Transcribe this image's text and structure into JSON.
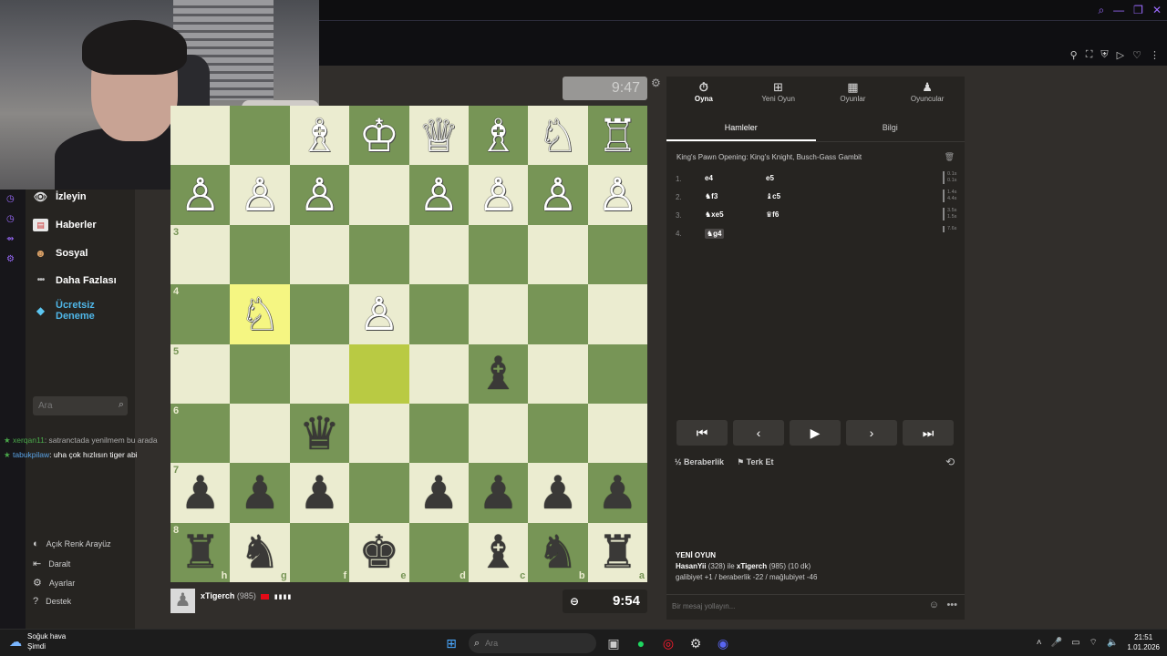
{
  "sidebar": {
    "items": [
      {
        "label": "İzleyin",
        "icon": "binoculars-icon"
      },
      {
        "label": "Haberler",
        "icon": "news-icon"
      },
      {
        "label": "Sosyal",
        "icon": "social-icon"
      },
      {
        "label": "Daha Fazlası",
        "icon": "more-icon"
      },
      {
        "label": "Ücretsiz Deneme",
        "icon": "diamond-icon"
      }
    ],
    "search_placeholder": "Ara",
    "bottom": [
      {
        "label": "Açık Renk Arayüz"
      },
      {
        "label": "Daralt"
      },
      {
        "label": "Ayarlar"
      },
      {
        "label": "Destek"
      }
    ]
  },
  "chat": [
    {
      "user": "xerqan11",
      "text": ": satranctada yenilmem bu arada"
    },
    {
      "user": "tabukpilaw",
      "text": ": uha çok hızlısın tiger abi"
    }
  ],
  "game": {
    "opponent_clock": "9:47",
    "player": {
      "name": "xTigerch",
      "rating": "(985)"
    },
    "player_clock": "9:54",
    "board": [
      [
        "",
        "",
        "♗",
        "♔",
        "♕",
        "♗",
        "♘",
        "♖"
      ],
      [
        "♙",
        "♙",
        "♙",
        "",
        "♙",
        "♙",
        "♙",
        "♙"
      ],
      [
        "",
        "",
        "",
        "",
        "",
        "",
        "",
        ""
      ],
      [
        "",
        "♘",
        "",
        "♙",
        "",
        "",
        "",
        ""
      ],
      [
        "",
        "",
        "",
        "",
        "",
        "♝",
        "",
        ""
      ],
      [
        "",
        "",
        "♛",
        "",
        "",
        "",
        "",
        ""
      ],
      [
        "♟",
        "♟",
        "♟",
        "",
        "♟",
        "♟",
        "♟",
        "♟"
      ],
      [
        "♜",
        "♞",
        "",
        "♚",
        "",
        "♝",
        "♞",
        "♜"
      ]
    ],
    "rank_labels": [
      "",
      "",
      "3",
      "4",
      "5",
      "6",
      "7",
      "8"
    ],
    "file_labels": [
      "h",
      "g",
      "f",
      "e",
      "d",
      "c",
      "b",
      "a"
    ],
    "highlight_light": "#f5f682",
    "highlight_dark": "#b9ca43",
    "board_light": "#ebecd0",
    "board_dark": "#779556"
  },
  "panel": {
    "tabs": [
      {
        "label": "Oyna",
        "icon": "stopwatch-icon"
      },
      {
        "label": "Yeni Oyun",
        "icon": "plus-icon"
      },
      {
        "label": "Oyunlar",
        "icon": "board-icon"
      },
      {
        "label": "Oyuncular",
        "icon": "players-icon"
      }
    ],
    "subtabs": [
      "Hamleler",
      "Bilgi"
    ],
    "opening": "King's Pawn Opening: King's Knight, Busch-Gass Gambit",
    "moves": [
      {
        "num": "1.",
        "white": "e4",
        "black": "e5",
        "times": [
          "0.1s",
          "0.1s"
        ]
      },
      {
        "num": "2.",
        "white": "♞f3",
        "black": "♝c5",
        "times": [
          "1.4s",
          "4.4s"
        ]
      },
      {
        "num": "3.",
        "white": "♞xe5",
        "black": "♛f6",
        "times": [
          "3.5s",
          "1.5s"
        ]
      },
      {
        "num": "4.",
        "white": "♞g4",
        "black": "",
        "times": [
          "7.6s",
          ""
        ]
      }
    ],
    "draw_label": "Beraberlik",
    "resign_label": "Terk Et",
    "new_game_title": "YENİ OYUN",
    "new_game_line1_a": "HasanYii",
    "new_game_line1_b": "(328) ile",
    "new_game_line1_c": "xTigerch",
    "new_game_line1_d": "(985) (10 dk)",
    "new_game_line2": "galibiyet +1 / beraberlik -22 / mağlubiyet -46",
    "message_placeholder": "Bir mesaj yollayın..."
  },
  "taskbar": {
    "weather_line1": "Soğuk hava",
    "weather_line2": "Şimdi",
    "search_placeholder": "Ara",
    "time": "21:51",
    "date": "1.01.2026"
  }
}
